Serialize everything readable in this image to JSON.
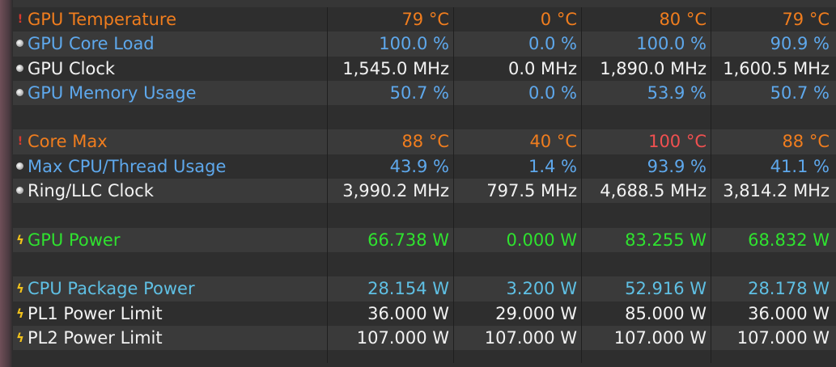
{
  "colors": {
    "temp": "#f07d1e",
    "load": "#5ea8ec",
    "clock": "#f2f2f2",
    "power": "#2fe22f",
    "pkg": "#5fc0e4",
    "alert": "#f05050"
  },
  "rows": [
    {
      "icon": "thermometer-icon",
      "label": "GPU Temperature",
      "values": [
        "79 °C",
        "0 °C",
        "80 °C",
        "79 °C"
      ]
    },
    {
      "icon": "clock-icon",
      "label": "GPU Core Load",
      "values": [
        "100.0 %",
        "0.0 %",
        "100.0 %",
        "90.9 %"
      ]
    },
    {
      "icon": "clock-icon",
      "label": "GPU Clock",
      "values": [
        "1,545.0 MHz",
        "0.0 MHz",
        "1,890.0 MHz",
        "1,600.5 MHz"
      ]
    },
    {
      "icon": "clock-icon",
      "label": "GPU Memory Usage",
      "values": [
        "50.7 %",
        "0.0 %",
        "53.9 %",
        "50.7 %"
      ]
    },
    {
      "icon": "thermometer-icon",
      "label": "Core Max",
      "values": [
        "88 °C",
        "40 °C",
        "100 °C",
        "88 °C"
      ]
    },
    {
      "icon": "clock-icon",
      "label": "Max CPU/Thread Usage",
      "values": [
        "43.9 %",
        "1.4 %",
        "93.9 %",
        "41.1 %"
      ]
    },
    {
      "icon": "clock-icon",
      "label": "Ring/LLC Clock",
      "values": [
        "3,990.2 MHz",
        "797.5 MHz",
        "4,688.5 MHz",
        "3,814.2 MHz"
      ]
    },
    {
      "icon": "bolt-icon",
      "label": "GPU Power",
      "values": [
        "66.738 W",
        "0.000 W",
        "83.255 W",
        "68.832 W"
      ]
    },
    {
      "icon": "bolt-icon",
      "label": "CPU Package Power",
      "values": [
        "28.154 W",
        "3.200 W",
        "52.916 W",
        "28.178 W"
      ]
    },
    {
      "icon": "bolt-icon",
      "label": "PL1 Power Limit",
      "values": [
        "36.000 W",
        "29.000 W",
        "85.000 W",
        "36.000 W"
      ]
    },
    {
      "icon": "bolt-icon",
      "label": "PL2 Power Limit",
      "values": [
        "107.000 W",
        "107.000 W",
        "107.000 W",
        "107.000 W"
      ]
    }
  ]
}
